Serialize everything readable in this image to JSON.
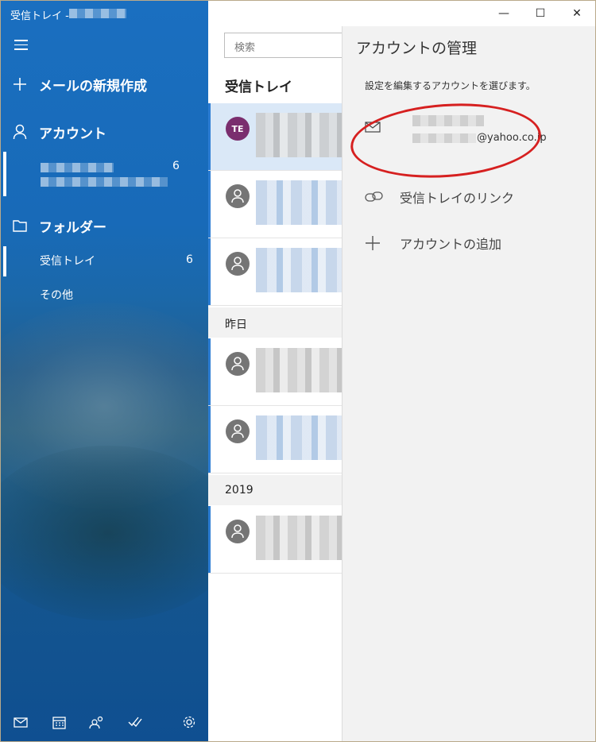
{
  "window": {
    "title": "受信トレイ - ",
    "controls": {
      "minimize": "—",
      "maximize": "☐",
      "close": "✕"
    }
  },
  "nav": {
    "new_mail": "メールの新規作成",
    "accounts": "アカウント",
    "account_count": "6",
    "folders": "フォルダー",
    "folder_items": [
      {
        "label": "受信トレイ",
        "count": "6"
      },
      {
        "label": "その他",
        "count": ""
      }
    ],
    "bottom_icons": [
      "mail-icon",
      "calendar-icon",
      "people-icon",
      "todo-icon",
      "settings-icon"
    ]
  },
  "list": {
    "search_placeholder": "検索",
    "title": "受信トレイ",
    "first_avatar": "TE",
    "groups": [
      {
        "label": "昨日"
      },
      {
        "label": "2019"
      }
    ]
  },
  "pane": {
    "title": "アカウントの管理",
    "subtitle": "設定を編集するアカウントを選びます。",
    "account_domain": "@yahoo.co.jp",
    "link_inbox": "受信トレイのリンク",
    "add_account": "アカウントの追加"
  },
  "colors": {
    "accent": "#2b7cd3",
    "avatar_te": "#7a2e6e",
    "highlight_oval": "#d62020"
  }
}
